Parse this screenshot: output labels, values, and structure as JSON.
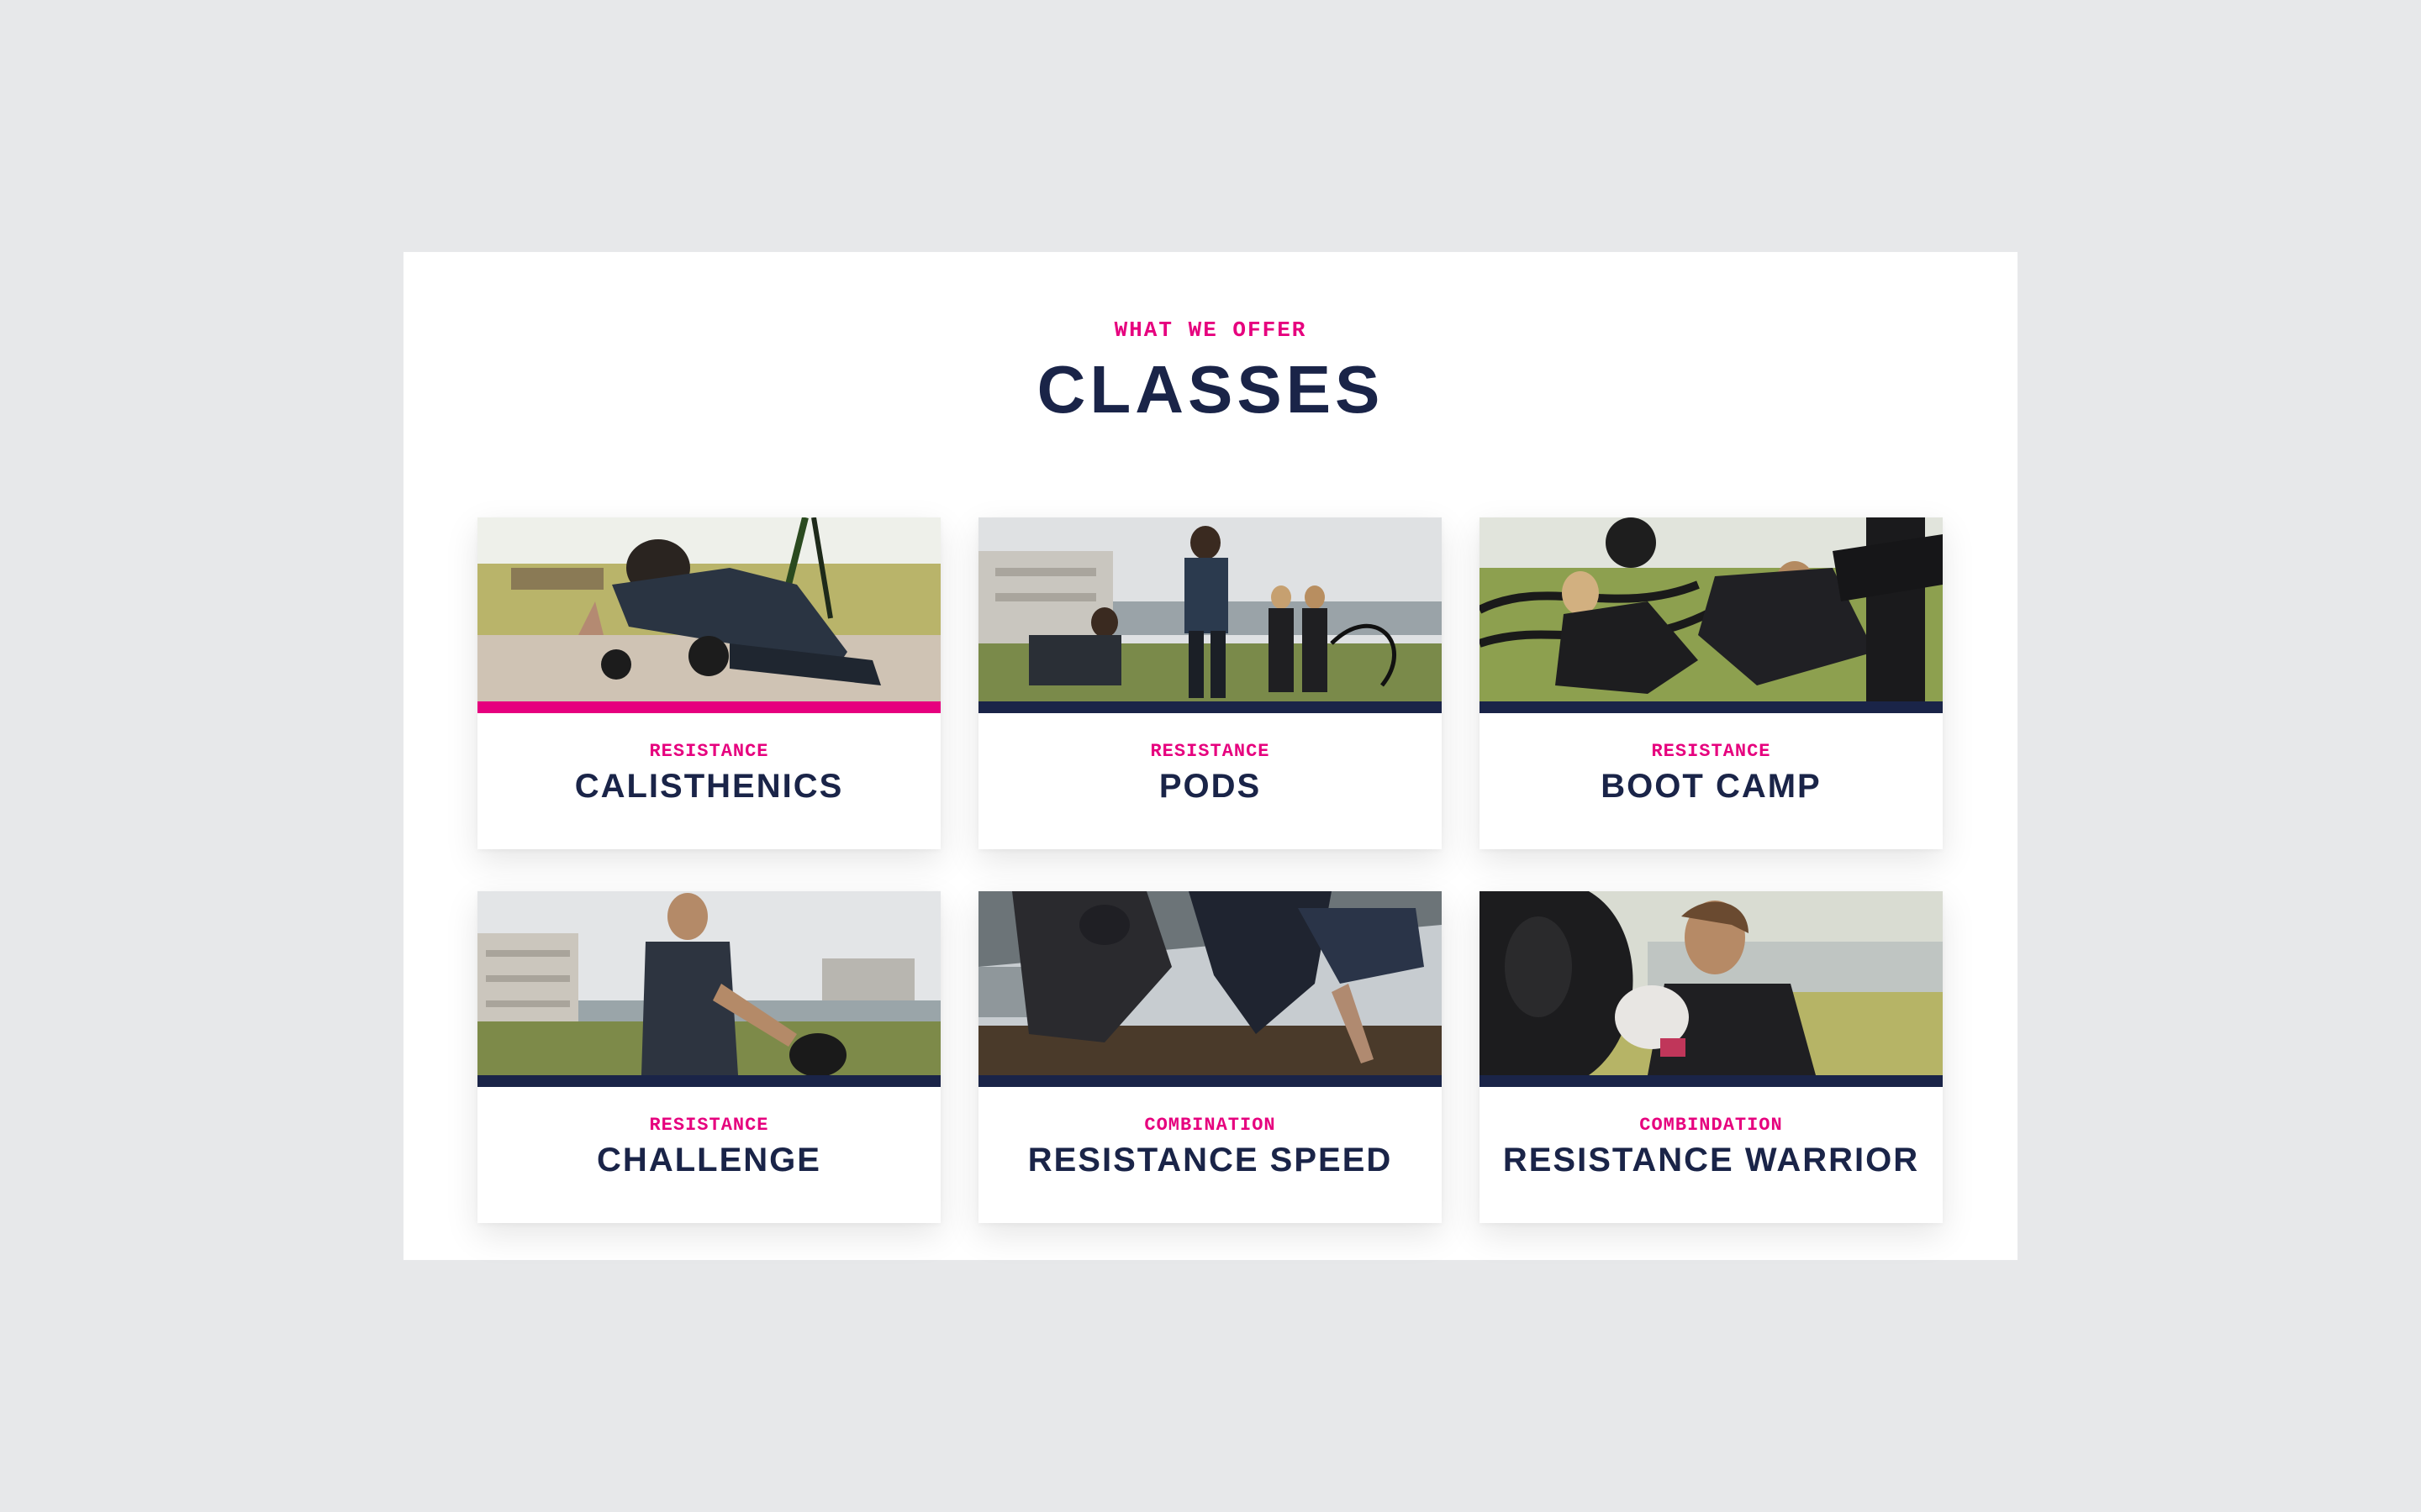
{
  "section": {
    "eyebrow": "WHAT WE OFFER",
    "title": "CLASSES"
  },
  "colors": {
    "accent": "#e6007e",
    "navy": "#1a2448",
    "page_background": "#e7e8ea",
    "panel_background": "#ffffff"
  },
  "classes": [
    {
      "category": "RESISTANCE",
      "name": "CALISTHENICS",
      "active": true,
      "image": "man-suspension-training-photo"
    },
    {
      "category": "RESISTANCE",
      "name": "PODS",
      "active": false,
      "image": "group-battle-ropes-photo"
    },
    {
      "category": "RESISTANCE",
      "name": "BOOT CAMP",
      "active": false,
      "image": "women-medicine-ball-photo"
    },
    {
      "category": "RESISTANCE",
      "name": "CHALLENGE",
      "active": false,
      "image": "man-kettlebell-swing-photo"
    },
    {
      "category": "COMBINATION",
      "name": "RESISTANCE SPEED",
      "active": false,
      "image": "group-bear-crawl-photo"
    },
    {
      "category": "COMBINDATION",
      "name": "RESISTANCE WARRIOR",
      "active": false,
      "image": "woman-boxing-gloves-photo"
    }
  ]
}
